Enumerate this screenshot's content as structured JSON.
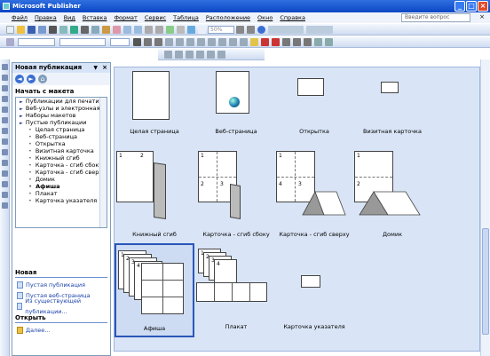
{
  "window": {
    "title": "Microsoft Publisher"
  },
  "menu": {
    "items": [
      "Файл",
      "Правка",
      "Вид",
      "Вставка",
      "Формат",
      "Сервис",
      "Таблица",
      "Расположение",
      "Окно",
      "Справка"
    ],
    "help_placeholder": "Введите вопрос"
  },
  "toolbar": {
    "zoom": "50%"
  },
  "task_pane": {
    "title": "Новая публикация",
    "start_label": "Начать с макета",
    "tree": [
      {
        "label": "Публикации для печати",
        "kind": "group"
      },
      {
        "label": "Веб-узлы и электронная почт",
        "kind": "group"
      },
      {
        "label": "Наборы макетов",
        "kind": "group"
      },
      {
        "label": "Пустые публикации",
        "kind": "group"
      },
      {
        "label": "Целая страница",
        "kind": "item"
      },
      {
        "label": "Веб-страница",
        "kind": "item"
      },
      {
        "label": "Открытка",
        "kind": "item"
      },
      {
        "label": "Визитная карточка",
        "kind": "item"
      },
      {
        "label": "Книжный сгиб",
        "kind": "item"
      },
      {
        "label": "Карточка - сгиб сбоку",
        "kind": "item"
      },
      {
        "label": "Карточка - сгиб сверху",
        "kind": "item"
      },
      {
        "label": "Домик",
        "kind": "item"
      },
      {
        "label": "Афиша",
        "kind": "item",
        "selected": true
      },
      {
        "label": "Плакат",
        "kind": "item"
      },
      {
        "label": "Карточка указателя",
        "kind": "item"
      }
    ],
    "new_section": {
      "title": "Новая",
      "links": [
        "Пустая публикация",
        "Пустая веб-страница",
        "Из существующей публикации..."
      ]
    },
    "open_section": {
      "title": "Открыть",
      "links": [
        "Далее..."
      ]
    }
  },
  "gallery": {
    "captions": [
      "Целая страница",
      "Веб-страница",
      "Открытка",
      "Визитная карточка",
      "Книжный сгиб",
      "Карточка - сгиб сбоку",
      "Карточка - сгиб сверху",
      "Домик",
      "Афиша",
      "Плакат",
      "Карточка указателя"
    ],
    "page_numbers": [
      "1",
      "2",
      "3",
      "4"
    ]
  }
}
